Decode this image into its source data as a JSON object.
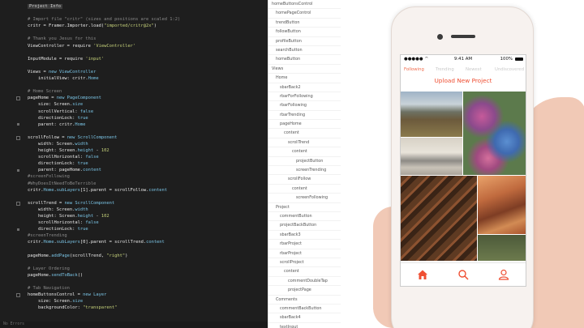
{
  "editor": {
    "lines": [
      {
        "segs": [
          [
            "tag",
            "Project Info"
          ]
        ]
      },
      {
        "segs": []
      },
      {
        "segs": [
          [
            "cm",
            "# Import file \"critr\" (sizes and positions are scaled 1:2)"
          ]
        ]
      },
      {
        "segs": [
          [
            "pr",
            "critr = Framer.Importer.load("
          ],
          [
            "st",
            "\"imported/critr@2x\""
          ],
          [
            "pr",
            ")"
          ]
        ]
      },
      {
        "segs": []
      },
      {
        "segs": [
          [
            "cm",
            "# Thank you Jesus for this"
          ]
        ]
      },
      {
        "segs": [
          [
            "pr",
            "ViewController = require "
          ],
          [
            "st",
            "'ViewController'"
          ]
        ]
      },
      {
        "segs": []
      },
      {
        "segs": [
          [
            "pr",
            "InputModule = require "
          ],
          [
            "st",
            "'input'"
          ]
        ]
      },
      {
        "segs": []
      },
      {
        "segs": [
          [
            "pr",
            "Views = "
          ],
          [
            "kw",
            "new ViewController"
          ]
        ]
      },
      {
        "segs": [
          [
            "pr",
            "    initialView: critr."
          ],
          [
            "kw",
            "Home"
          ]
        ]
      },
      {
        "segs": []
      },
      {
        "segs": [
          [
            "cm",
            "# Home Screen"
          ]
        ]
      },
      {
        "segs": [
          [
            "pr",
            "pageHome = "
          ],
          [
            "kw",
            "new PageComponent"
          ]
        ]
      },
      {
        "segs": [
          [
            "pr",
            "    size: Screen."
          ],
          [
            "kw",
            "size"
          ]
        ]
      },
      {
        "segs": [
          [
            "pr",
            "    scrollVertical: "
          ],
          [
            "kw",
            "false"
          ]
        ]
      },
      {
        "segs": [
          [
            "pr",
            "    directionLock: "
          ],
          [
            "kw",
            "true"
          ]
        ]
      },
      {
        "segs": [
          [
            "pr",
            "    parent: critr."
          ],
          [
            "kw",
            "Home"
          ]
        ]
      },
      {
        "segs": []
      },
      {
        "segs": [
          [
            "pr",
            "scrollFollow = "
          ],
          [
            "kw",
            "new ScrollComponent"
          ]
        ]
      },
      {
        "segs": [
          [
            "pr",
            "    width: Screen."
          ],
          [
            "kw",
            "width"
          ]
        ]
      },
      {
        "segs": [
          [
            "pr",
            "    height: Screen."
          ],
          [
            "kw",
            "height"
          ],
          [
            "pr",
            " - "
          ],
          [
            "st",
            "102"
          ]
        ]
      },
      {
        "segs": [
          [
            "pr",
            "    scrollHorizontal: "
          ],
          [
            "kw",
            "false"
          ]
        ]
      },
      {
        "segs": [
          [
            "pr",
            "    directionLock: "
          ],
          [
            "kw",
            "true"
          ]
        ]
      },
      {
        "segs": [
          [
            "pr",
            "    parent: pageHome."
          ],
          [
            "kw",
            "content"
          ]
        ]
      },
      {
        "segs": [
          [
            "cm",
            "#screenFollowing"
          ]
        ]
      },
      {
        "segs": [
          [
            "cm",
            "#WhyDoesItNeedToBeTerrible"
          ]
        ]
      },
      {
        "segs": [
          [
            "pr",
            "critr."
          ],
          [
            "kw",
            "Home"
          ],
          [
            "pr",
            "."
          ],
          [
            "kw",
            "subLayers"
          ],
          [
            "pr",
            "[1].parent = scrollFollow."
          ],
          [
            "kw",
            "content"
          ]
        ]
      },
      {
        "segs": []
      },
      {
        "segs": [
          [
            "pr",
            "scrollTrend = "
          ],
          [
            "kw",
            "new ScrollComponent"
          ]
        ]
      },
      {
        "segs": [
          [
            "pr",
            "    width: Screen."
          ],
          [
            "kw",
            "width"
          ]
        ]
      },
      {
        "segs": [
          [
            "pr",
            "    height: Screen."
          ],
          [
            "kw",
            "height"
          ],
          [
            "pr",
            " - "
          ],
          [
            "st",
            "102"
          ]
        ]
      },
      {
        "segs": [
          [
            "pr",
            "    scrollHorizontal: "
          ],
          [
            "kw",
            "false"
          ]
        ]
      },
      {
        "segs": [
          [
            "pr",
            "    directionLock: "
          ],
          [
            "kw",
            "true"
          ]
        ]
      },
      {
        "segs": [
          [
            "cm",
            "#screenTrending"
          ]
        ]
      },
      {
        "segs": [
          [
            "pr",
            "critr."
          ],
          [
            "kw",
            "Home"
          ],
          [
            "pr",
            "."
          ],
          [
            "kw",
            "subLayers"
          ],
          [
            "pr",
            "[0].parent = scrollTrend."
          ],
          [
            "kw",
            "content"
          ]
        ]
      },
      {
        "segs": []
      },
      {
        "segs": [
          [
            "pr",
            "pageHome."
          ],
          [
            "kw",
            "addPage"
          ],
          [
            "pr",
            "(scrollTrend, "
          ],
          [
            "st",
            "\"right\""
          ],
          [
            "pr",
            ")"
          ]
        ]
      },
      {
        "segs": []
      },
      {
        "segs": [
          [
            "cm",
            "# Layer Ordering"
          ]
        ]
      },
      {
        "segs": [
          [
            "pr",
            "pageHome."
          ],
          [
            "kw",
            "sendToBack"
          ],
          [
            "pr",
            "()"
          ]
        ]
      },
      {
        "segs": []
      },
      {
        "segs": [
          [
            "cm",
            "# Tab Navigation"
          ]
        ]
      },
      {
        "segs": [
          [
            "pr",
            "homeButtonsControl = "
          ],
          [
            "kw",
            "new Layer"
          ]
        ]
      },
      {
        "segs": [
          [
            "pr",
            "    size: Screen."
          ],
          [
            "kw",
            "size"
          ]
        ]
      },
      {
        "segs": [
          [
            "pr",
            "    backgroundColor: "
          ],
          [
            "st",
            "\"transparent\""
          ]
        ]
      }
    ],
    "status": "No Errors",
    "colors": {
      "background": "#1e1e1e",
      "comment": "#8a8a8a",
      "keyword": "#7bc5e6",
      "string": "#c6d27a"
    }
  },
  "layers": [
    {
      "label": "homeButtonsControl",
      "level": 0
    },
    {
      "label": "homePageControl",
      "level": 1
    },
    {
      "label": "trendButton",
      "level": 1
    },
    {
      "label": "followButton",
      "level": 1
    },
    {
      "label": "profileButton",
      "level": 1
    },
    {
      "label": "searchButton",
      "level": 1
    },
    {
      "label": "homeButton",
      "level": 1
    },
    {
      "label": "Views",
      "level": 0
    },
    {
      "label": "Home",
      "level": 1
    },
    {
      "label": "sbarBack2",
      "level": 2
    },
    {
      "label": "rbarForFollowing",
      "level": 2
    },
    {
      "label": "rbarFollowing",
      "level": 2
    },
    {
      "label": "rbarTrending",
      "level": 2
    },
    {
      "label": "pageHome",
      "level": 2
    },
    {
      "label": "content",
      "level": 3
    },
    {
      "label": "scrollTrend",
      "level": 4
    },
    {
      "label": "content",
      "level": 5
    },
    {
      "label": "projectButton",
      "level": 6
    },
    {
      "label": "screenTrending",
      "level": 6
    },
    {
      "label": "scrollFollow",
      "level": 4
    },
    {
      "label": "content",
      "level": 5
    },
    {
      "label": "screenFollowing",
      "level": 6
    },
    {
      "label": "Project",
      "level": 1
    },
    {
      "label": "commentButton",
      "level": 2
    },
    {
      "label": "projectBackButton",
      "level": 2
    },
    {
      "label": "sbarBack3",
      "level": 2
    },
    {
      "label": "rbarProject",
      "level": 2
    },
    {
      "label": "rbarProject",
      "level": 2
    },
    {
      "label": "scrollProject",
      "level": 2
    },
    {
      "label": "content",
      "level": 3
    },
    {
      "label": "commentDoubleTap",
      "level": 4
    },
    {
      "label": "projectPage",
      "level": 4
    },
    {
      "label": "Comments",
      "level": 1
    },
    {
      "label": "commentBackButton",
      "level": 2
    },
    {
      "label": "sbarBack4",
      "level": 2
    },
    {
      "label": "textInput",
      "level": 2
    }
  ],
  "phone": {
    "status_time": "9:41 AM",
    "battery": "100%",
    "tabs": [
      "Following",
      "Trending",
      "Newest",
      "Undiscovered"
    ],
    "active_tab": "Following",
    "upload_label": "Upload New Project",
    "accent": "#ef4f33",
    "nav_icons": [
      "home-icon",
      "search-icon",
      "profile-icon"
    ]
  }
}
